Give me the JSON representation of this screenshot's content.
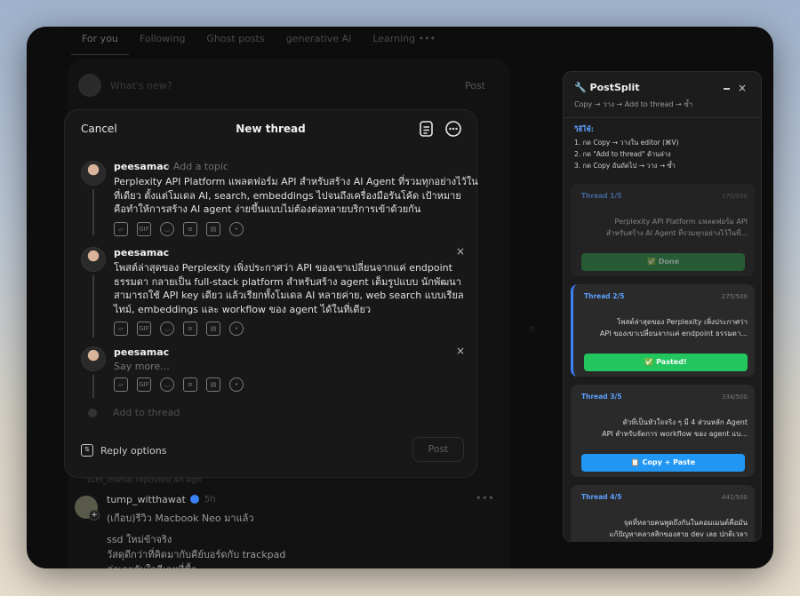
{
  "feed": {
    "tabs": [
      "For you",
      "Following",
      "Ghost posts",
      "generative AI",
      "Learning •••"
    ],
    "composer_placeholder": "What's new?",
    "composer_post": "Post",
    "meta_line": "tum_lnwhai reposted 4h ago",
    "post": {
      "username": "tump_witthawat",
      "time": "5h",
      "more": "•••",
      "lines": [
        "(เกือบ)รีวิว Macbook Neo มาแล้ว",
        "ssd ใหม่ข้าจริง",
        "วัสดุดีกว่าที่คิดมากับคีย์บอร์ดกับ trackpad",
        "ค่าเลยกับใจดีเลยที่ซื้อ"
      ]
    }
  },
  "modal": {
    "cancel": "Cancel",
    "title": "New thread",
    "posts": [
      {
        "username": "peesamac",
        "topic": "Add a topic",
        "lines": [
          "Perplexity API Platform แพลตฟอร์ม API สำหรับสร้าง AI Agent ที่รวมทุกอย่างไว้ใน",
          "ที่เดียว ตั้งแต่โมเดล AI, search, embeddings ไปจนถึงเครื่องมือรันโค้ด เป้าหมาย",
          "คือทำให้การสร้าง AI agent ง่ายขึ้นแบบไม่ต้องต่อหลายบริการเข้าด้วยกัน"
        ]
      },
      {
        "username": "peesamac",
        "close": "×",
        "lines": [
          "โพสต์ล่าสุดของ Perplexity เพิ่งประกาศว่า API ของเขาเปลี่ยนจากแค่ endpoint",
          "ธรรมดา กลายเป็น full-stack platform สำหรับสร้าง agent เต็มรูปแบบ นักพัฒนา",
          "สามารถใช้ API key เดียว แล้วเรียกทั้งโมเดล AI หลายค่าย, web search แบบเรียล",
          "ไทม์, embeddings และ workflow ของ agent ได้ในที่เดียว"
        ]
      },
      {
        "username": "peesamac",
        "close": "×",
        "placeholder": "Say more..."
      }
    ],
    "toolbar_icons": [
      "image-icon",
      "gif-icon",
      "emoji-icon",
      "poll-icon",
      "document-icon",
      "location-icon"
    ],
    "add_to_thread": "Add to thread",
    "reply_options": "Reply options",
    "post_button": "Post"
  },
  "panel": {
    "title": "🔧 PostSplit",
    "subtitle": "Copy → วาง → Add to thread → ซ้ำ",
    "minimize": "–",
    "close": "×",
    "howto_title": "วิธีใช้:",
    "howto_steps": [
      "1. กด Copy → วางใน editor (⌘V)",
      "2. กด \"Add to thread\" ด้านล่าง",
      "3. กด Copy อันถัดไป → วาง → ซ้ำ"
    ],
    "cards": [
      {
        "label": "Thread 1/5",
        "count": "175/500",
        "lines": [
          "Perplexity API Platform แพลตฟอร์ม API",
          "สำหรับสร้าง AI Agent ที่รวมทุกอย่างไว้ในที่..."
        ],
        "button": "✅ Done"
      },
      {
        "label": "Thread 2/5",
        "count": "275/500",
        "lines": [
          "โพสต์ล่าสุดของ Perplexity เพิ่งประกาศว่า",
          "API ของเขาเปลี่ยนจากแค่ endpoint ธรรมดา..."
        ],
        "button": "✅ Pasted!"
      },
      {
        "label": "Thread 3/5",
        "count": "334/500",
        "lines": [
          "ตัวที่เป็นหัวใจจริง ๆ มี 4 ส่วนหลัก Agent",
          "API สำหรับจัดการ workflow ของ agent แบ..."
        ],
        "button": "📋 Copy + Paste"
      },
      {
        "label": "Thread 4/5",
        "count": "441/500",
        "lines": [
          "จุดที่หลายคนพูดถึงกันในคอมเมนต์คือมัน",
          "แก้ปัญหาคลาสสิกของสาย dev เลย ปกติเวลา"
        ],
        "button": ""
      }
    ],
    "colors": {
      "accent": "#3b82f6",
      "done": "#2f8f4a",
      "pasted": "#22c55e",
      "copy": "#2196f3"
    }
  }
}
